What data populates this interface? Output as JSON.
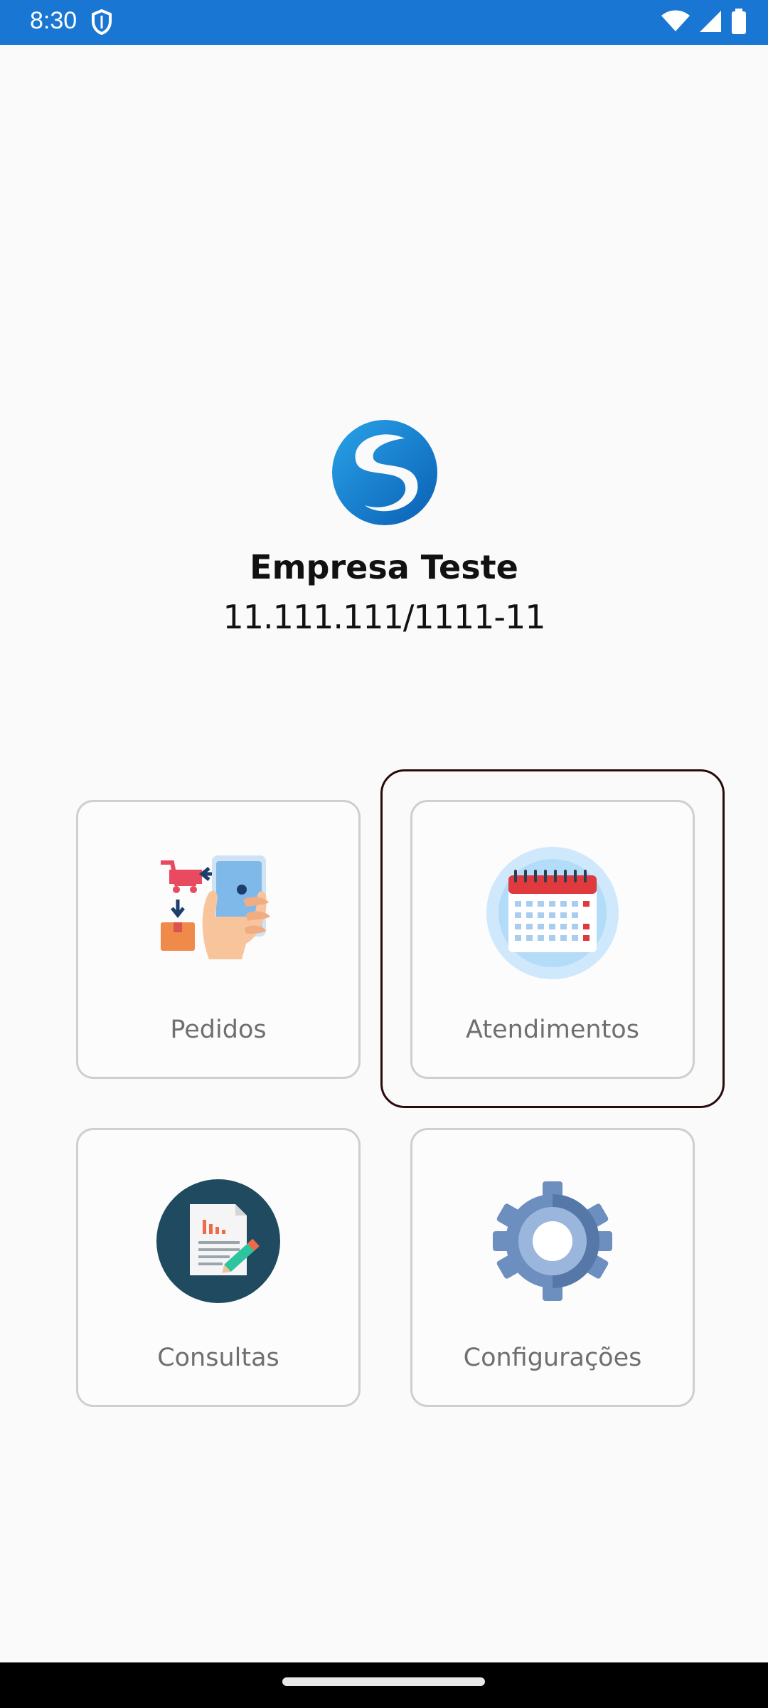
{
  "status_bar": {
    "time": "8:30",
    "icons": [
      "shield-icon",
      "wifi-icon",
      "signal-icon",
      "battery-icon"
    ],
    "color": "#1976d2"
  },
  "company": {
    "name": "Empresa Teste",
    "id": "11.111.111/1111-11",
    "logo": "company-logo"
  },
  "menu": [
    {
      "label": "Pedidos",
      "icon": "order-phone-cart-icon"
    },
    {
      "label": "Atendimentos",
      "icon": "calendar-icon",
      "focused": true
    },
    {
      "label": "Consultas",
      "icon": "report-document-icon"
    },
    {
      "label": "Configurações",
      "icon": "gear-icon"
    }
  ]
}
